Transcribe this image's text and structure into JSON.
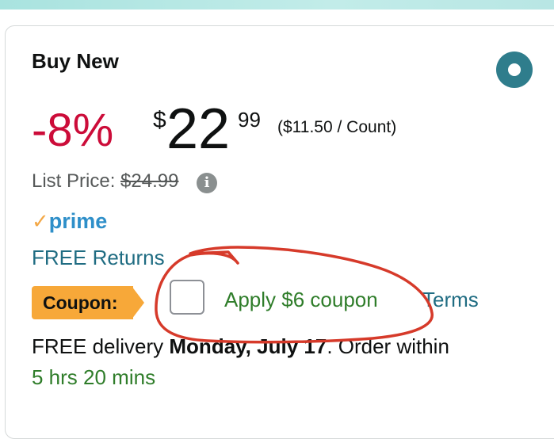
{
  "card": {
    "title": "Buy New",
    "selected": true
  },
  "price": {
    "discount": "-8%",
    "currency_symbol": "$",
    "whole": "22",
    "fraction": "99",
    "unit_price": "($11.50 / Count)",
    "list_price_label": "List Price:",
    "list_price_value": "$24.99"
  },
  "prime": {
    "check": "✓",
    "label": "prime"
  },
  "returns": {
    "label": "FREE Returns"
  },
  "coupon": {
    "badge_label": "Coupon:",
    "checked": false,
    "apply_label": "Apply $6 coupon",
    "terms_label": "Terms"
  },
  "delivery": {
    "prefix": "FREE delivery ",
    "date": "Monday, July 17",
    "suffix": ". Order within",
    "countdown": "5 hrs 20 mins"
  },
  "colors": {
    "discount": "#cc0c39",
    "link": "#1f6c82",
    "green": "#2f7d2a",
    "coupon_badge": "#f7a839",
    "radio": "#2f7d8c",
    "annotation": "#d63a2a"
  },
  "icons": {
    "info": "info-icon",
    "prime_check": "check-icon",
    "radio": "radio-selected-icon"
  }
}
